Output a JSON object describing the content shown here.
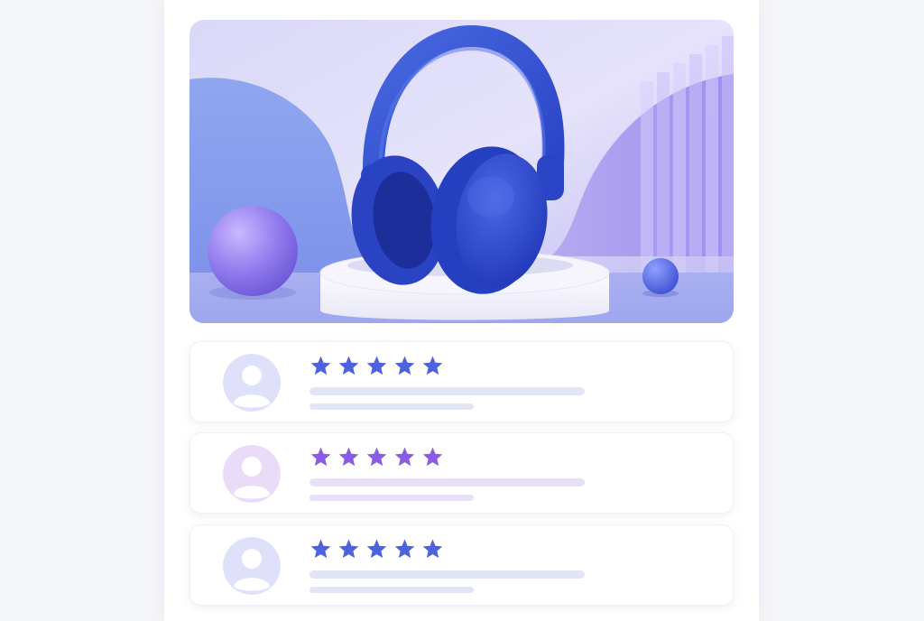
{
  "hero": {
    "image": "blue-headphones-product-photo",
    "colors": {
      "headphones": "#2f4fd0",
      "background": "#c9c6f4",
      "pedestal": "#f4f3fb"
    }
  },
  "reviews": [
    {
      "avatar": "user-avatar-icon",
      "rating": 5,
      "max_rating": 5,
      "accent": "#4d62dc",
      "avatar_bg": "#dfe1fb",
      "line_color": "#e2e5f3"
    },
    {
      "avatar": "user-avatar-icon",
      "rating": 5,
      "max_rating": 5,
      "accent": "#8a5ce6",
      "avatar_bg": "#eadcf9",
      "line_color": "#e8e0f6"
    },
    {
      "avatar": "user-avatar-icon",
      "rating": 5,
      "max_rating": 5,
      "accent": "#4d62dc",
      "avatar_bg": "#dfe1fb",
      "line_color": "#e2e5f3"
    }
  ]
}
